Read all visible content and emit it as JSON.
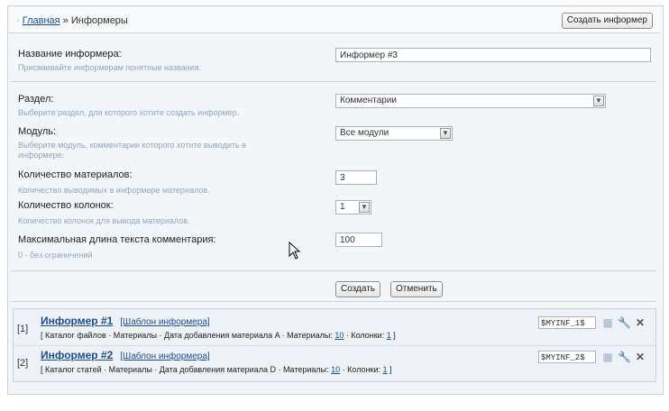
{
  "breadcrumb": {
    "home": "Главная",
    "separator": "»",
    "current": "Информеры"
  },
  "create_button": "Создать информер",
  "form": {
    "name": {
      "label": "Название информера:",
      "hint": "Присваивайте информерам понятные названия.",
      "value": "Информер #3"
    },
    "section": {
      "label": "Раздел:",
      "hint": "Выберите раздел, для которого хотите создать информер.",
      "value": "Комментарии"
    },
    "module": {
      "label": "Модуль:",
      "hint": "Выберите модуль, комментарии которого хотите выводить в информере.",
      "value": "Все модули"
    },
    "count": {
      "label": "Количество материалов:",
      "hint": "Количество выводимых в информере материалов.",
      "value": "3"
    },
    "columns": {
      "label": "Количество колонок:",
      "hint": "Количество колонок для вывода материалов.",
      "value": "1"
    },
    "maxlen": {
      "label": "Максимальная длина текста комментария:",
      "hint": "0 - без ограничений",
      "value": "100"
    },
    "submit": "Создать",
    "cancel": "Отменить"
  },
  "informers": [
    {
      "num": "[1]",
      "title": "Информер #1",
      "template": "[Шаблон информера]",
      "desc_prefix": "[ Каталог файлов · Материалы · Дата добавления материала A · Материалы: ",
      "materials": "10",
      "desc_mid": " · Колонки: ",
      "columns": "1",
      "desc_suffix": " ]",
      "code": "$MYINF_1$"
    },
    {
      "num": "[2]",
      "title": "Информер #2",
      "template": "[Шаблон информера]",
      "desc_prefix": "[ Каталог статей · Материалы · Дата добавления материала D · Материалы: ",
      "materials": "10",
      "desc_mid": " · Колонки: ",
      "columns": "1",
      "desc_suffix": " ]",
      "code": "$MYINF_2$"
    }
  ]
}
